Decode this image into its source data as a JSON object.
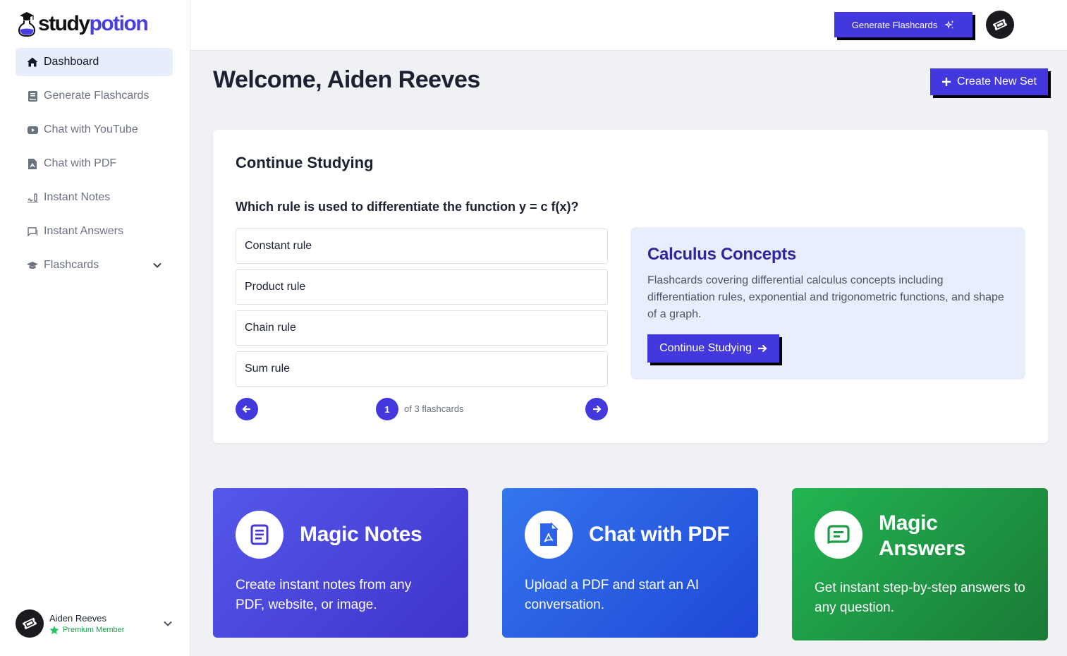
{
  "brand": {
    "part1": "study",
    "part2": "potion",
    "accent": "#4338dd"
  },
  "sidebar": {
    "items": [
      {
        "label": "Dashboard",
        "icon": "home-icon",
        "active": true
      },
      {
        "label": "Generate Flashcards",
        "icon": "book-icon"
      },
      {
        "label": "Chat with YouTube",
        "icon": "youtube-icon"
      },
      {
        "label": "Chat with PDF",
        "icon": "pdf-file-icon"
      },
      {
        "label": "Instant Notes",
        "icon": "signature-icon"
      },
      {
        "label": "Instant Answers",
        "icon": "chat-bubble-icon"
      },
      {
        "label": "Flashcards",
        "icon": "graduation-cap-icon",
        "expandable": true
      }
    ],
    "user": {
      "name": "Aiden Reeves",
      "badge": "Premium Member"
    }
  },
  "topbar": {
    "generate_label": "Generate Flashcards"
  },
  "main": {
    "welcome": "Welcome, Aiden Reeves",
    "create_label": "Create New Set",
    "continue": {
      "title": "Continue Studying",
      "question": "Which rule is used to differentiate the function y = c f(x)?",
      "options": [
        "Constant rule",
        "Product rule",
        "Chain rule",
        "Sum rule"
      ],
      "current": "1",
      "total_text": "of 3 flashcards",
      "deck": {
        "title": "Calculus Concepts",
        "description": "Flashcards covering differential calculus concepts including differentiation rules, exponential and trigonometric functions, and shape of a graph.",
        "button": "Continue Studying"
      }
    },
    "features": [
      {
        "title": "Magic Notes",
        "description": "Create instant notes from any PDF, website, or image.",
        "color": "#4f4ee3"
      },
      {
        "title": "Chat with PDF",
        "description": "Upload a PDF and start an AI conversation.",
        "color": "#2d63e6"
      },
      {
        "title": "Magic Answers",
        "description": "Get instant step-by-step answers to any question.",
        "color": "#1f9e47"
      }
    ]
  }
}
